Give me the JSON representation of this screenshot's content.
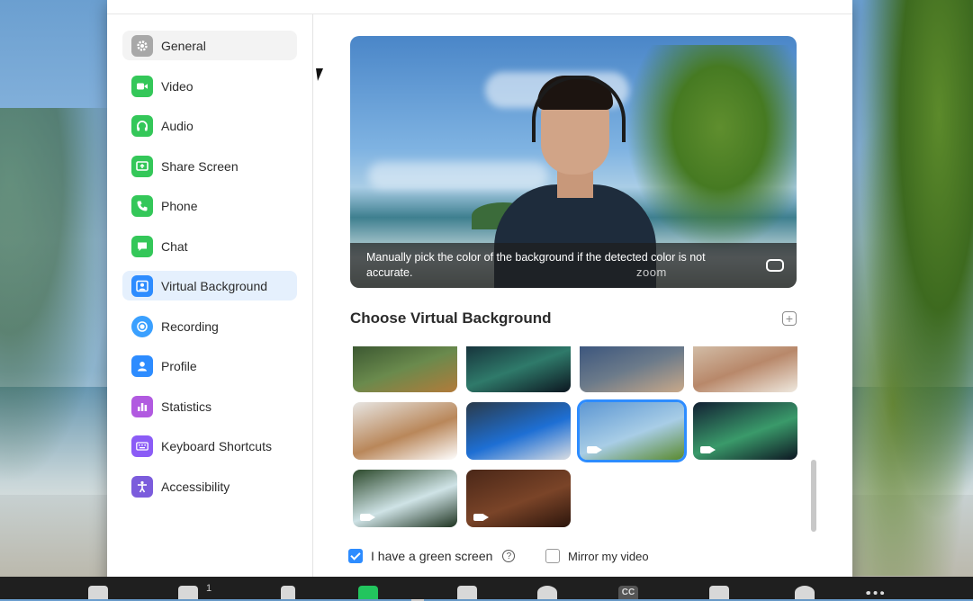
{
  "sidebar": {
    "items": [
      {
        "label": "General",
        "icon": "gear-icon",
        "color": "#9a9a9a",
        "state": "hover"
      },
      {
        "label": "Video",
        "icon": "video-camera-icon",
        "color": "#34c759",
        "state": ""
      },
      {
        "label": "Audio",
        "icon": "headphones-icon",
        "color": "#34c759",
        "state": ""
      },
      {
        "label": "Share Screen",
        "icon": "share-screen-icon",
        "color": "#34c759",
        "state": ""
      },
      {
        "label": "Phone",
        "icon": "phone-icon",
        "color": "#34c759",
        "state": ""
      },
      {
        "label": "Chat",
        "icon": "chat-bubble-icon",
        "color": "#34c759",
        "state": ""
      },
      {
        "label": "Virtual Background",
        "icon": "person-frame-icon",
        "color": "#2d8cff",
        "state": "active"
      },
      {
        "label": "Recording",
        "icon": "record-icon",
        "color": "#2d8cff",
        "state": ""
      },
      {
        "label": "Profile",
        "icon": "user-icon",
        "color": "#2d8cff",
        "state": ""
      },
      {
        "label": "Statistics",
        "icon": "bar-chart-icon",
        "color": "#b15ae0",
        "state": ""
      },
      {
        "label": "Keyboard Shortcuts",
        "icon": "keyboard-icon",
        "color": "#8b5cf6",
        "state": ""
      },
      {
        "label": "Accessibility",
        "icon": "accessibility-icon",
        "color": "#7b5cdc",
        "state": ""
      }
    ]
  },
  "preview": {
    "caption": "Manually pick the color of the background if the detected color is not accurate.",
    "watermark": "zoom"
  },
  "backgrounds": {
    "title": "Choose Virtual Background",
    "items": [
      {
        "name": "plants",
        "selected": false,
        "video": false,
        "colors": [
          "#2f4a2a",
          "#6a8a4d",
          "#b27b3a"
        ]
      },
      {
        "name": "aurora",
        "selected": false,
        "video": false,
        "colors": [
          "#10202f",
          "#2f7a6a",
          "#0c1620"
        ]
      },
      {
        "name": "office-wall",
        "selected": false,
        "video": false,
        "colors": [
          "#2f4c7a",
          "#6b7a8a",
          "#c9a98a"
        ]
      },
      {
        "name": "office-lounge",
        "selected": false,
        "video": false,
        "colors": [
          "#d9cbb7",
          "#b8886a",
          "#efe9df"
        ]
      },
      {
        "name": "reception-desk",
        "selected": false,
        "video": false,
        "colors": [
          "#e7e5e2",
          "#b9875a",
          "#ffffff"
        ]
      },
      {
        "name": "zoom-office",
        "selected": false,
        "video": false,
        "colors": [
          "#2a3a4a",
          "#1e6fd4",
          "#d9dde2"
        ]
      },
      {
        "name": "beach-palm",
        "selected": true,
        "video": true,
        "colors": [
          "#5d97d3",
          "#a8cde6",
          "#5a8a2e"
        ]
      },
      {
        "name": "northern-lights",
        "selected": false,
        "video": true,
        "colors": [
          "#122033",
          "#3a9a6a",
          "#0d1622"
        ]
      },
      {
        "name": "waterfall",
        "selected": false,
        "video": true,
        "colors": [
          "#2d4a2c",
          "#cfe3e6",
          "#1e3320"
        ]
      },
      {
        "name": "coffee-beans",
        "selected": false,
        "video": true,
        "colors": [
          "#4a2718",
          "#7a4428",
          "#2c150c"
        ]
      }
    ]
  },
  "options": {
    "green_screen_label": "I have a green screen",
    "green_screen_checked": true,
    "mirror_label": "Mirror my video",
    "mirror_checked": false
  },
  "taskbar": {
    "cc_label": "CC",
    "participants_count": "1"
  },
  "colors": {
    "accent": "#2d8cff",
    "active_bg": "#e5f0fd"
  }
}
